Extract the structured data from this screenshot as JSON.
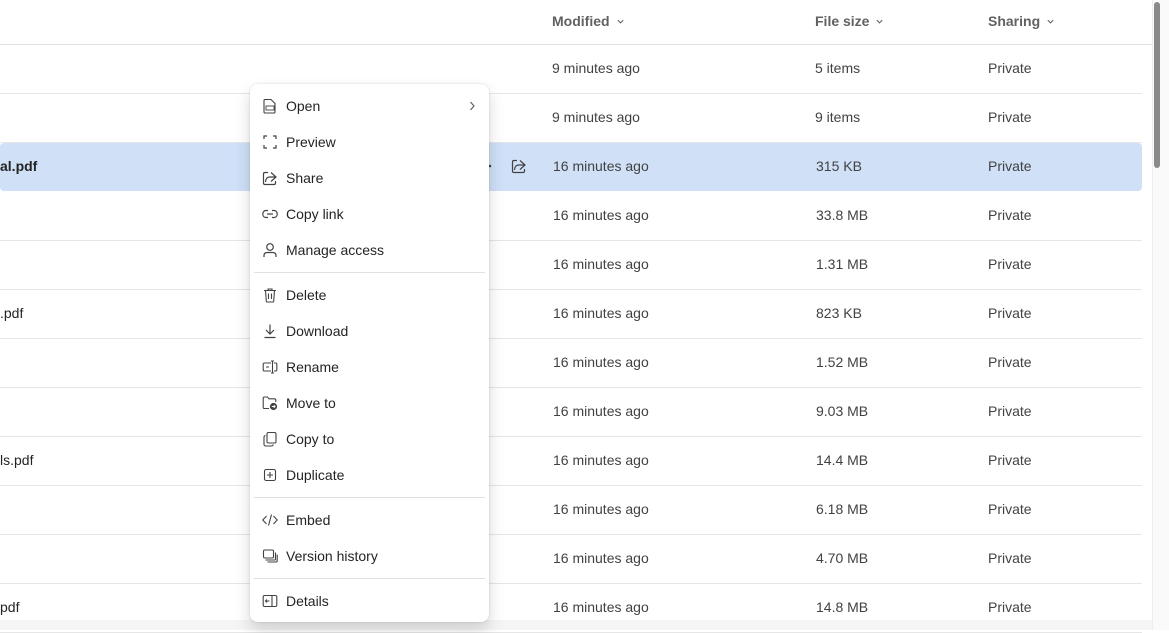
{
  "columns": {
    "modified": "Modified",
    "file_size": "File size",
    "sharing": "Sharing"
  },
  "rows": [
    {
      "name": "",
      "modified": "9 minutes ago",
      "size": "5 items",
      "sharing": "Private"
    },
    {
      "name": "",
      "modified": "9 minutes ago",
      "size": "9 items",
      "sharing": "Private"
    },
    {
      "name": "al.pdf",
      "modified": "16 minutes ago",
      "size": "315 KB",
      "sharing": "Private",
      "selected": true
    },
    {
      "name": "",
      "modified": "16 minutes ago",
      "size": "33.8 MB",
      "sharing": "Private"
    },
    {
      "name": "",
      "modified": "16 minutes ago",
      "size": "1.31 MB",
      "sharing": "Private"
    },
    {
      "name": ".pdf",
      "modified": "16 minutes ago",
      "size": "823 KB",
      "sharing": "Private"
    },
    {
      "name": "",
      "modified": "16 minutes ago",
      "size": "1.52 MB",
      "sharing": "Private"
    },
    {
      "name": "",
      "modified": "16 minutes ago",
      "size": "9.03 MB",
      "sharing": "Private"
    },
    {
      "name": "ls.pdf",
      "modified": "16 minutes ago",
      "size": "14.4 MB",
      "sharing": "Private"
    },
    {
      "name": "",
      "modified": "16 minutes ago",
      "size": "6.18 MB",
      "sharing": "Private"
    },
    {
      "name": "",
      "modified": "16 minutes ago",
      "size": "4.70 MB",
      "sharing": "Private"
    },
    {
      "name": "pdf",
      "modified": "16 minutes ago",
      "size": "14.8 MB",
      "sharing": "Private"
    }
  ],
  "context_menu": {
    "open": "Open",
    "preview": "Preview",
    "share": "Share",
    "copy_link": "Copy link",
    "manage_access": "Manage access",
    "delete": "Delete",
    "download": "Download",
    "rename": "Rename",
    "move_to": "Move to",
    "copy_to": "Copy to",
    "duplicate": "Duplicate",
    "embed": "Embed",
    "version_history": "Version history",
    "details": "Details"
  },
  "icons": {
    "sort": "chevron-down-icon",
    "row_share": "share-icon",
    "row_more": "more-icon"
  },
  "colors": {
    "selected_row": "#cfe0f7",
    "text": "#242424",
    "muted": "#616161"
  }
}
